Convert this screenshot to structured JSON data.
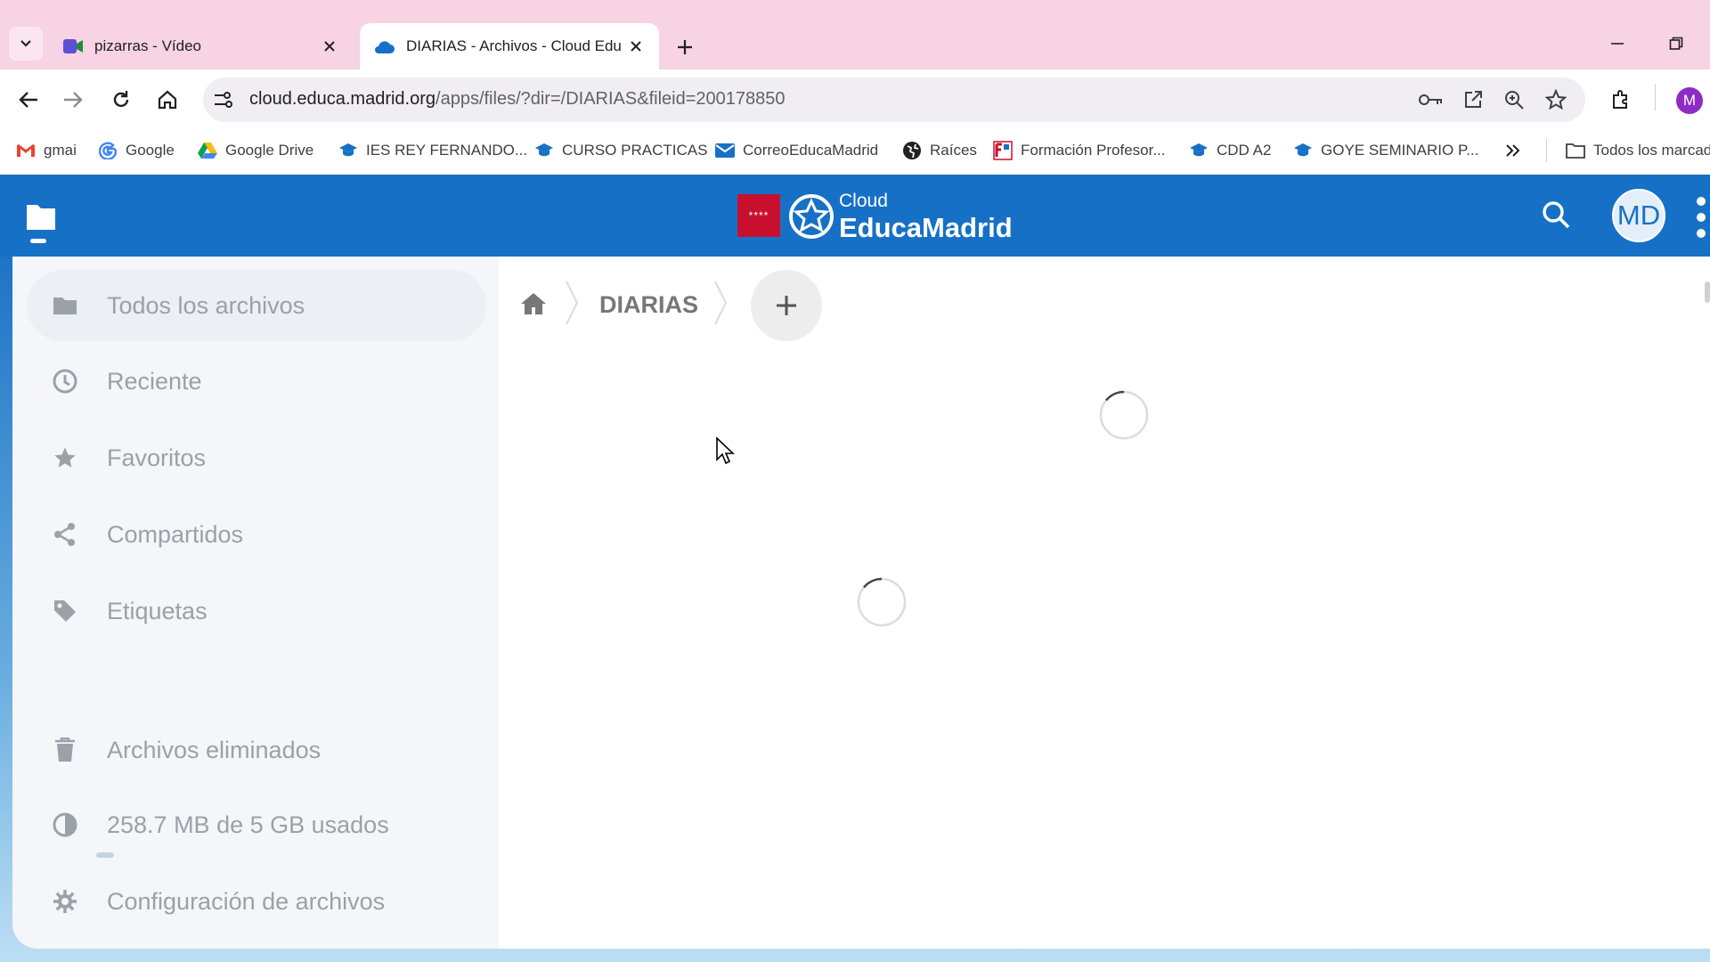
{
  "browser": {
    "tabs": [
      {
        "title": "pizarras - Vídeo",
        "active": false,
        "icon": "video-icon"
      },
      {
        "title": "DIARIAS - Archivos - Cloud Edu",
        "active": true,
        "icon": "cloud-icon"
      }
    ],
    "url": {
      "domain": "cloud.educa.madrid.org",
      "path": "/apps/files/?dir=/DIARIAS&fileid=200178850"
    },
    "profile_initial": "M",
    "bookmarks": [
      {
        "label": "gmai",
        "icon": "gmail-icon"
      },
      {
        "label": "Google",
        "icon": "google-icon"
      },
      {
        "label": "Google Drive",
        "icon": "drive-icon"
      },
      {
        "label": "IES REY FERNANDO...",
        "icon": "grad-cap-icon"
      },
      {
        "label": "CURSO PRACTICAS",
        "icon": "grad-cap-icon"
      },
      {
        "label": "CorreoEducaMadrid",
        "icon": "mail-icon"
      },
      {
        "label": "Raíces",
        "icon": "globe-icon"
      },
      {
        "label": "Formación Profesor...",
        "icon": "fp-icon"
      },
      {
        "label": "CDD A2",
        "icon": "grad-cap-icon"
      },
      {
        "label": "GOYE SEMINARIO P...",
        "icon": "grad-cap-icon"
      }
    ],
    "all_bookmarks_label": "Todos los marcadores",
    "colors": {
      "tab_strip": "#f7d3e3",
      "omnibox": "#f1eef3"
    }
  },
  "app": {
    "logo_sub": "Cloud",
    "logo_main": "EducaMadrid",
    "flag_stars": "****",
    "avatar_initials": "MD",
    "colors": {
      "header": "#1671c6",
      "flag": "#c8102e"
    }
  },
  "sidebar": {
    "items": [
      {
        "label": "Todos los archivos",
        "icon": "folder-icon",
        "active": true
      },
      {
        "label": "Reciente",
        "icon": "clock-icon"
      },
      {
        "label": "Favoritos",
        "icon": "star-icon"
      },
      {
        "label": "Compartidos",
        "icon": "share-icon"
      },
      {
        "label": "Etiquetas",
        "icon": "tag-icon"
      }
    ],
    "deleted": {
      "label": "Archivos eliminados",
      "icon": "trash-icon"
    },
    "quota": {
      "label": "258.7 MB de 5 GB usados",
      "icon": "pie-chart-icon",
      "used_fraction": 0.05
    },
    "settings": {
      "label": "Configuración de archivos",
      "icon": "gear-icon"
    }
  },
  "main": {
    "breadcrumb": {
      "home_icon": "home-icon",
      "current": "DIARIAS",
      "add_icon": "plus-icon"
    },
    "loading": true
  }
}
